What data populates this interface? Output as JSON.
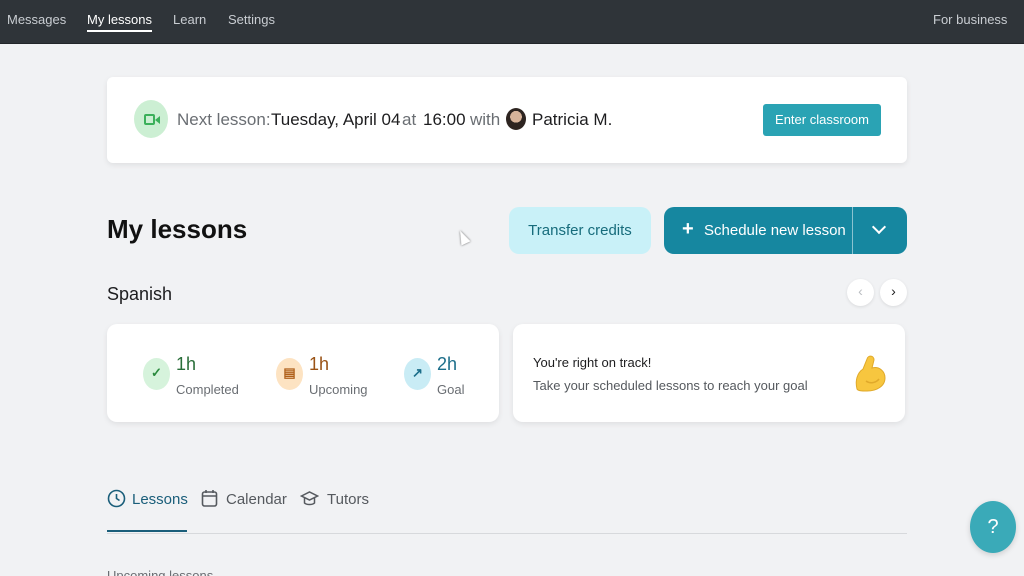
{
  "nav": {
    "items": [
      {
        "label": "Messages"
      },
      {
        "label": "My lessons"
      },
      {
        "label": "Learn"
      },
      {
        "label": "Settings"
      }
    ],
    "business_label": "For business"
  },
  "next_lesson": {
    "prefix": "Next lesson:",
    "date": "Tuesday, April 04",
    "at": "at",
    "time": "16:00",
    "with": "with",
    "tutor": "Patricia M.",
    "enter_label": "Enter classroom"
  },
  "page_title": "My lessons",
  "actions": {
    "transfer_label": "Transfer credits",
    "schedule_label": "Schedule new lesson",
    "schedule_plus": "+"
  },
  "language": "Spanish",
  "carousel": {
    "prev": "‹",
    "next": "›"
  },
  "stats": [
    {
      "value": "1h",
      "label": "Completed",
      "icon": "check-icon",
      "glyph": "✓",
      "color": "#2a8a3e"
    },
    {
      "value": "1h",
      "label": "Upcoming",
      "icon": "calendar-icon",
      "glyph": "▤",
      "color": "#b0601a"
    },
    {
      "value": "2h",
      "label": "Goal",
      "icon": "trend-up-icon",
      "glyph": "↗",
      "color": "#1c6e8a"
    }
  ],
  "track": {
    "title": "You're right on track!",
    "description": "Take your scheduled lessons to reach your goal",
    "icon": "flexed-arm-icon"
  },
  "tabs": [
    {
      "label": "Lessons",
      "icon": "clock-icon"
    },
    {
      "label": "Calendar",
      "icon": "calendar-icon"
    },
    {
      "label": "Tutors",
      "icon": "graduation-cap-icon"
    }
  ],
  "section_peek": "Upcoming lessons",
  "help_label": "?"
}
